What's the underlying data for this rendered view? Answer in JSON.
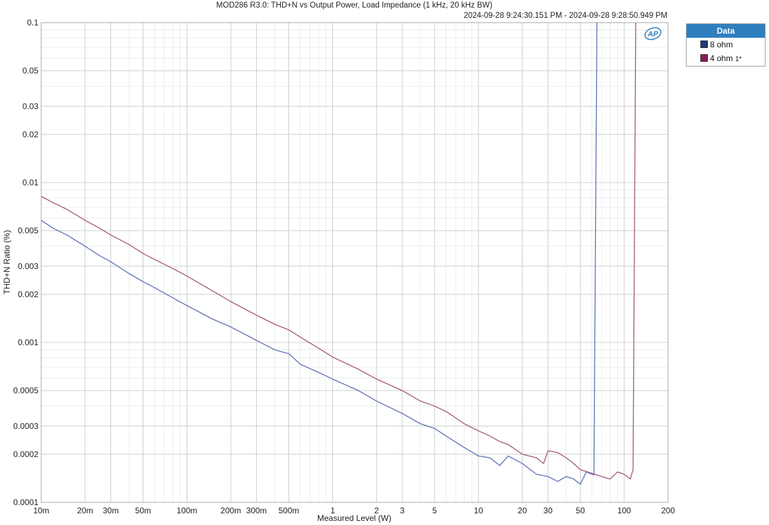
{
  "chart_data": {
    "type": "line",
    "title": "MOD286 R3.0: THD+N vs Output Power, Load Impedance (1 kHz, 20 kHz BW)",
    "subtitle": "2024-09-28 9:24:30.151 PM - 2024-09-28 9:28:50.949 PM",
    "xlabel": "Measured Level (W)",
    "ylabel": "THD+N Ratio (%)",
    "x_scale": "log",
    "y_scale": "log",
    "xlim": [
      0.01,
      200
    ],
    "ylim": [
      0.0001,
      0.1
    ],
    "x_ticks": [
      {
        "value": 0.01,
        "label": "10m"
      },
      {
        "value": 0.02,
        "label": "20m"
      },
      {
        "value": 0.03,
        "label": "30m"
      },
      {
        "value": 0.05,
        "label": "50m"
      },
      {
        "value": 0.1,
        "label": "100m"
      },
      {
        "value": 0.2,
        "label": "200m"
      },
      {
        "value": 0.3,
        "label": "300m"
      },
      {
        "value": 0.5,
        "label": "500m"
      },
      {
        "value": 1,
        "label": "1"
      },
      {
        "value": 2,
        "label": "2"
      },
      {
        "value": 3,
        "label": "3"
      },
      {
        "value": 5,
        "label": "5"
      },
      {
        "value": 10,
        "label": "10"
      },
      {
        "value": 20,
        "label": "20"
      },
      {
        "value": 30,
        "label": "30"
      },
      {
        "value": 50,
        "label": "50"
      },
      {
        "value": 100,
        "label": "100"
      },
      {
        "value": 200,
        "label": "200"
      }
    ],
    "y_ticks": [
      {
        "value": 0.1,
        "label": "0.1"
      },
      {
        "value": 0.05,
        "label": "0.05"
      },
      {
        "value": 0.03,
        "label": "0.03"
      },
      {
        "value": 0.02,
        "label": "0.02"
      },
      {
        "value": 0.01,
        "label": "0.01"
      },
      {
        "value": 0.005,
        "label": "0.005"
      },
      {
        "value": 0.003,
        "label": "0.003"
      },
      {
        "value": 0.002,
        "label": "0.002"
      },
      {
        "value": 0.001,
        "label": "0.001"
      },
      {
        "value": 0.0005,
        "label": "0.0005"
      },
      {
        "value": 0.0003,
        "label": "0.0003"
      },
      {
        "value": 0.0002,
        "label": "0.0002"
      },
      {
        "value": 0.0001,
        "label": "0.0001"
      }
    ],
    "grid": true,
    "legend": {
      "title": "Data",
      "placement": "top-right outside",
      "entries": [
        {
          "label": "8 ohm",
          "color": "#1f3a7a"
        },
        {
          "label": "4 ohm",
          "suffix": "1*",
          "color": "#8b1a5c"
        }
      ]
    },
    "series": [
      {
        "name": "8 ohm",
        "color": "#5b72b5",
        "points": [
          [
            0.01,
            0.0058
          ],
          [
            0.012,
            0.0052
          ],
          [
            0.015,
            0.0047
          ],
          [
            0.02,
            0.004
          ],
          [
            0.025,
            0.0035
          ],
          [
            0.03,
            0.0032
          ],
          [
            0.04,
            0.0027
          ],
          [
            0.05,
            0.0024
          ],
          [
            0.06,
            0.0022
          ],
          [
            0.08,
            0.0019
          ],
          [
            0.1,
            0.0017
          ],
          [
            0.15,
            0.0014
          ],
          [
            0.2,
            0.00125
          ],
          [
            0.3,
            0.00103
          ],
          [
            0.4,
            0.0009
          ],
          [
            0.5,
            0.00085
          ],
          [
            0.6,
            0.00073
          ],
          [
            0.8,
            0.00065
          ],
          [
            1,
            0.00059
          ],
          [
            1.5,
            0.0005
          ],
          [
            2,
            0.00043
          ],
          [
            3,
            0.00036
          ],
          [
            4,
            0.00031
          ],
          [
            5,
            0.00029
          ],
          [
            6,
            0.00026
          ],
          [
            8,
            0.00022
          ],
          [
            10,
            0.000195
          ],
          [
            12,
            0.00019
          ],
          [
            14,
            0.00017
          ],
          [
            16,
            0.000195
          ],
          [
            20,
            0.000175
          ],
          [
            25,
            0.00015
          ],
          [
            30,
            0.000145
          ],
          [
            35,
            0.000135
          ],
          [
            40,
            0.000145
          ],
          [
            45,
            0.00014
          ],
          [
            50,
            0.00013
          ],
          [
            55,
            0.000155
          ],
          [
            62,
            0.000148
          ],
          [
            65,
            0.1
          ]
        ]
      },
      {
        "name": "4 ohm",
        "color": "#a0587f",
        "points": [
          [
            0.01,
            0.0082
          ],
          [
            0.012,
            0.0075
          ],
          [
            0.015,
            0.0068
          ],
          [
            0.02,
            0.0058
          ],
          [
            0.025,
            0.0052
          ],
          [
            0.03,
            0.0047
          ],
          [
            0.04,
            0.0041
          ],
          [
            0.05,
            0.0036
          ],
          [
            0.06,
            0.0033
          ],
          [
            0.08,
            0.0029
          ],
          [
            0.1,
            0.0026
          ],
          [
            0.15,
            0.0021
          ],
          [
            0.2,
            0.0018
          ],
          [
            0.3,
            0.00148
          ],
          [
            0.4,
            0.0013
          ],
          [
            0.5,
            0.0012
          ],
          [
            0.6,
            0.00108
          ],
          [
            0.8,
            0.00092
          ],
          [
            1,
            0.00081
          ],
          [
            1.5,
            0.00068
          ],
          [
            2,
            0.00059
          ],
          [
            3,
            0.0005
          ],
          [
            4,
            0.00043
          ],
          [
            5,
            0.0004
          ],
          [
            6,
            0.00037
          ],
          [
            8,
            0.00031
          ],
          [
            10,
            0.00028
          ],
          [
            12,
            0.00026
          ],
          [
            14,
            0.00024
          ],
          [
            16,
            0.00023
          ],
          [
            20,
            0.0002
          ],
          [
            25,
            0.00019
          ],
          [
            28,
            0.000175
          ],
          [
            30,
            0.00021
          ],
          [
            35,
            0.000205
          ],
          [
            40,
            0.00019
          ],
          [
            45,
            0.000175
          ],
          [
            50,
            0.00016
          ],
          [
            60,
            0.000152
          ],
          [
            70,
            0.000145
          ],
          [
            80,
            0.00014
          ],
          [
            90,
            0.000155
          ],
          [
            100,
            0.00015
          ],
          [
            110,
            0.00014
          ],
          [
            115,
            0.00016
          ],
          [
            120,
            0.1
          ]
        ]
      }
    ]
  }
}
